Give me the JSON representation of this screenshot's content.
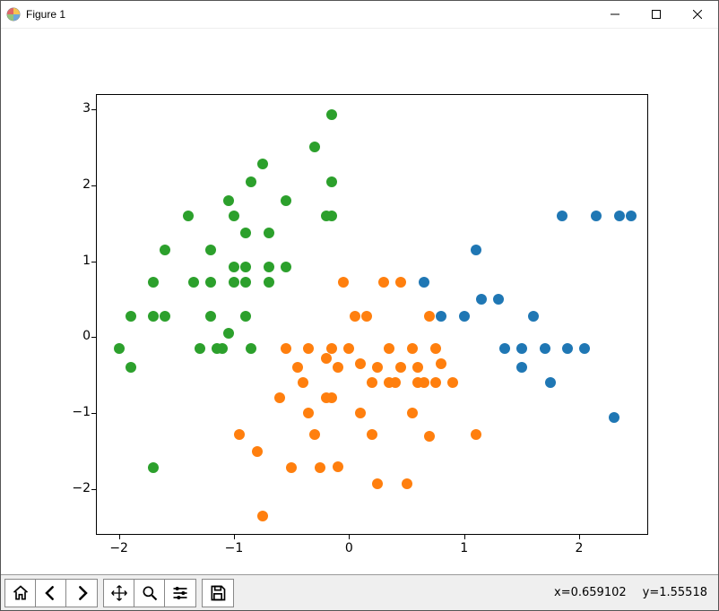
{
  "window": {
    "title": "Figure 1"
  },
  "toolbar": {
    "coord_x_label": "x=0.659102",
    "coord_y_label": "y=1.55518"
  },
  "chart_data": {
    "type": "scatter",
    "xlim": [
      -2.2,
      2.6
    ],
    "ylim": [
      -2.6,
      3.2
    ],
    "xticks": [
      -2,
      -1,
      0,
      1,
      2
    ],
    "yticks": [
      -2,
      -1,
      0,
      1,
      2,
      3
    ],
    "series": [
      {
        "name": "green",
        "color": "#2ca02c",
        "x": [
          -2.0,
          -1.9,
          -1.9,
          -1.7,
          -1.7,
          -1.6,
          -1.6,
          -1.4,
          -1.35,
          -1.3,
          -1.2,
          -1.2,
          -1.2,
          -1.15,
          -1.1,
          -1.05,
          -1.05,
          -1.0,
          -1.0,
          -1.0,
          -0.9,
          -0.9,
          -0.9,
          -0.9,
          -0.85,
          -0.85,
          -0.75,
          -0.7,
          -0.7,
          -0.7,
          -0.55,
          -0.55,
          -0.3,
          -0.2,
          -0.15,
          -0.15,
          -0.15,
          -1.7
        ],
        "y": [
          -0.15,
          0.28,
          -0.4,
          0.72,
          0.28,
          1.15,
          0.28,
          1.6,
          0.72,
          -0.15,
          1.15,
          0.72,
          0.28,
          -0.15,
          -0.15,
          1.8,
          0.05,
          1.6,
          0.93,
          0.72,
          1.37,
          0.93,
          0.72,
          0.28,
          2.05,
          -0.15,
          2.28,
          1.37,
          0.93,
          0.72,
          1.8,
          0.93,
          2.5,
          1.6,
          2.93,
          2.05,
          1.6,
          -1.72
        ]
      },
      {
        "name": "orange",
        "color": "#ff7f0e",
        "x": [
          -0.95,
          -0.8,
          -0.75,
          -0.6,
          -0.55,
          -0.5,
          -0.45,
          -0.4,
          -0.35,
          -0.35,
          -0.3,
          -0.25,
          -0.2,
          -0.2,
          -0.15,
          -0.15,
          -0.1,
          -0.1,
          -0.05,
          0.0,
          0.05,
          0.1,
          0.1,
          0.15,
          0.2,
          0.2,
          0.25,
          0.25,
          0.3,
          0.35,
          0.35,
          0.4,
          0.45,
          0.45,
          0.5,
          0.55,
          0.55,
          0.6,
          0.6,
          0.65,
          0.7,
          0.7,
          0.75,
          0.75,
          0.8,
          0.9,
          1.1
        ],
        "y": [
          -1.28,
          -1.5,
          -2.35,
          -0.8,
          -0.15,
          -1.72,
          -0.4,
          -0.6,
          -0.15,
          -1.0,
          -1.28,
          -1.72,
          -0.28,
          -0.8,
          -0.15,
          -0.8,
          -0.4,
          -1.7,
          0.72,
          -0.15,
          0.28,
          -0.35,
          -1.0,
          0.28,
          -0.6,
          -1.28,
          -0.4,
          -1.93,
          0.72,
          -0.15,
          -0.6,
          -0.6,
          0.72,
          -0.4,
          -1.93,
          -0.15,
          -1.0,
          -0.4,
          -0.6,
          -0.6,
          -1.3,
          0.28,
          -0.15,
          -0.6,
          -0.35,
          -0.6,
          -1.28
        ]
      },
      {
        "name": "blue",
        "color": "#1f77b4",
        "x": [
          0.65,
          0.8,
          1.0,
          1.1,
          1.15,
          1.3,
          1.35,
          1.5,
          1.5,
          1.6,
          1.7,
          1.75,
          1.85,
          1.9,
          2.05,
          2.15,
          2.3,
          2.35,
          2.45
        ],
        "y": [
          0.72,
          0.28,
          0.28,
          1.15,
          0.5,
          0.5,
          -0.15,
          -0.15,
          -0.4,
          0.28,
          -0.15,
          -0.6,
          1.6,
          -0.15,
          -0.15,
          1.6,
          -1.05,
          1.6,
          1.6
        ]
      }
    ]
  }
}
